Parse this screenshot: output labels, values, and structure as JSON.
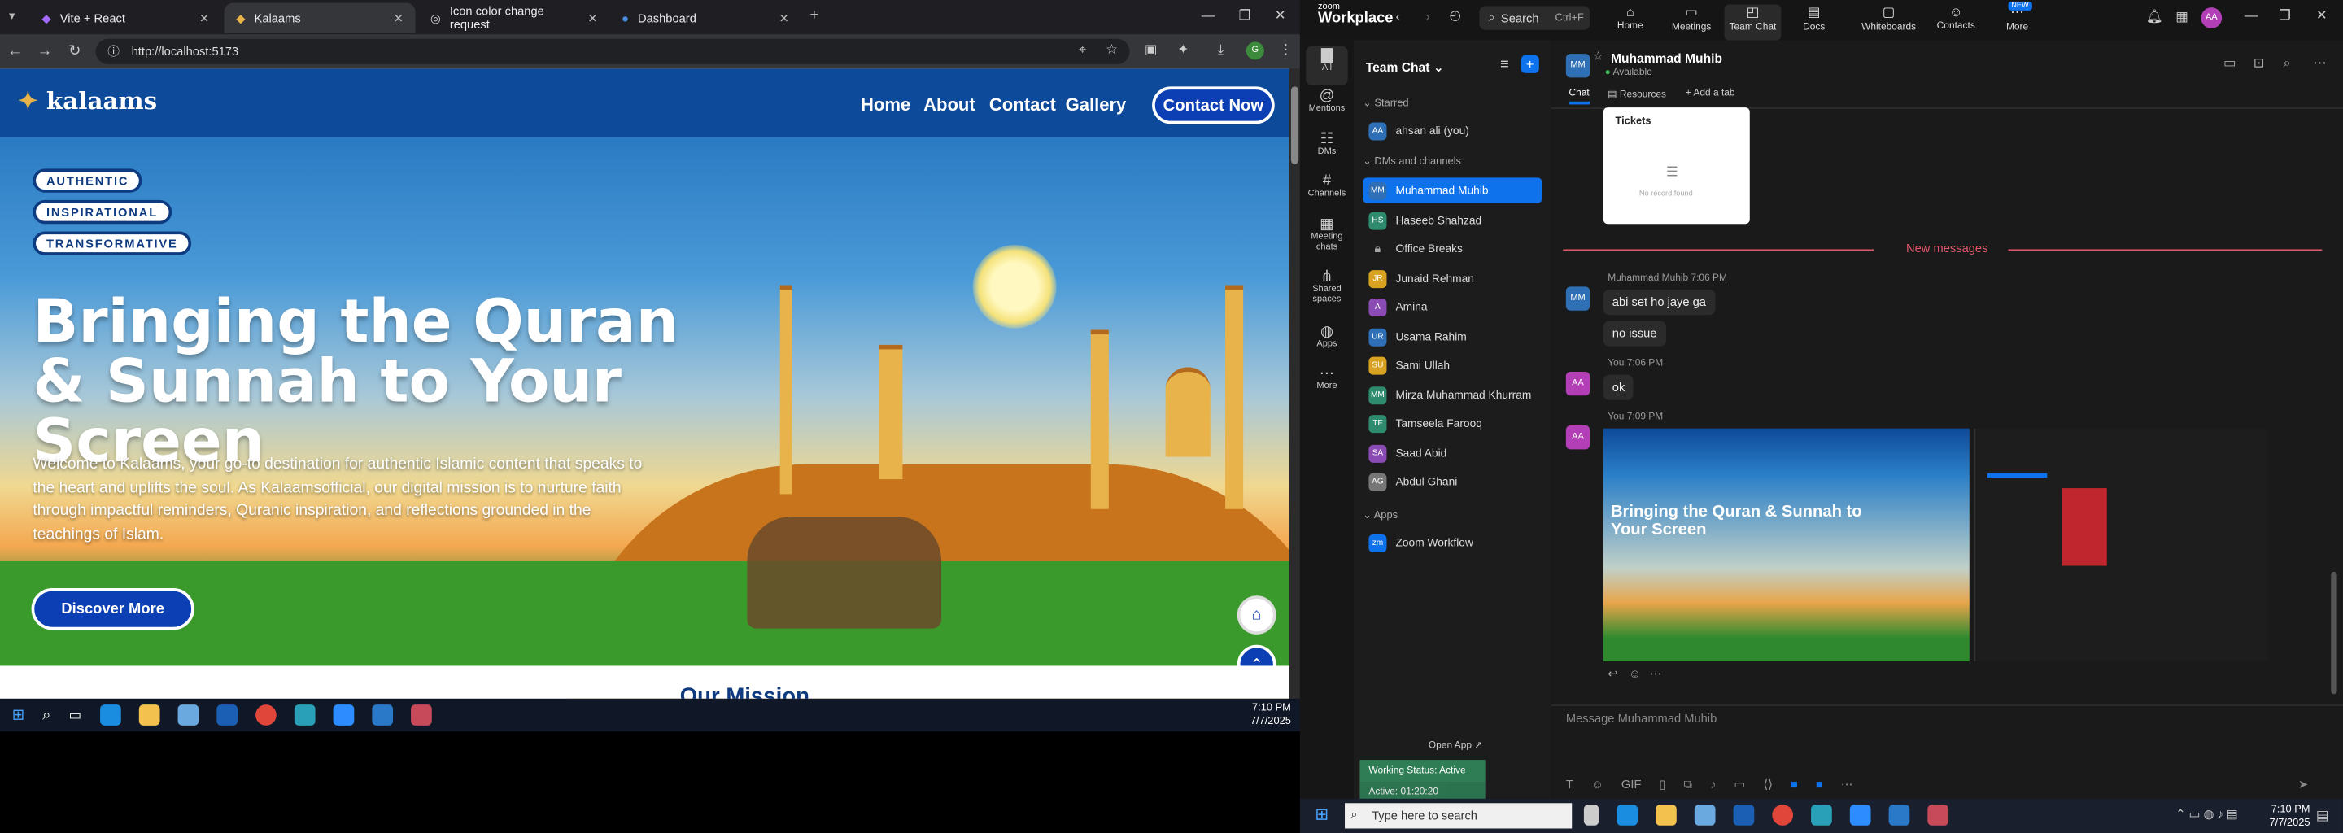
{
  "browser": {
    "tabs": [
      {
        "label": "Vite + React"
      },
      {
        "label": "Kalaams"
      },
      {
        "label": "Icon color change request"
      },
      {
        "label": "Dashboard"
      }
    ],
    "url": "http://localhost:5173"
  },
  "site": {
    "logo": "kalaams",
    "nav": [
      "Home",
      "About",
      "Contact",
      "Gallery"
    ],
    "contact_button": "Contact Now",
    "pills": [
      "AUTHENTIC",
      "INSPIRATIONAL",
      "TRANSFORMATIVE"
    ],
    "hero_title": "Bringing the Quran & Sunnah to Your Screen",
    "hero_text": "Welcome to Kalaams, your go-to destination for authentic Islamic content that speaks to the heart and uplifts the soul. As Kalaamsofficial, our digital mission is to nurture faith through impactful reminders, Quranic inspiration, and reflections grounded in the teachings of Islam.",
    "discover_button": "Discover More",
    "below_hint": "Our Mission"
  },
  "taskbar_left": {
    "time": "7:10 PM",
    "date": "7/7/2025"
  },
  "zoom": {
    "brand_top": "zoom",
    "brand": "Workplace",
    "search_label": "Search",
    "search_shortcut": "Ctrl+F",
    "top_tabs": [
      "Home",
      "Meetings",
      "Team Chat",
      "Docs",
      "Whiteboards",
      "Contacts",
      "More"
    ],
    "new_badge": "NEW",
    "avatar": "AA",
    "rail": [
      "All",
      "Mentions",
      "DMs",
      "Channels",
      "Meeting chats",
      "Shared spaces",
      "Apps",
      "More"
    ],
    "list_title": "Team Chat",
    "starred_label": "Starred",
    "starred": [
      {
        "name": "ahsan ali (you)",
        "initials": "AA"
      }
    ],
    "dms_label": "DMs and channels",
    "dms": [
      {
        "name": "Muhammad Muhib",
        "initials": "MM"
      },
      {
        "name": "Haseeb Shahzad",
        "initials": "HS"
      },
      {
        "name": "Office Breaks",
        "initials": ""
      },
      {
        "name": "Junaid Rehman",
        "initials": "JR"
      },
      {
        "name": "Amina",
        "initials": "A"
      },
      {
        "name": "Usama Rahim",
        "initials": "UR"
      },
      {
        "name": "Sami Ullah",
        "initials": "SU"
      },
      {
        "name": "Mirza Muhammad Khurram",
        "initials": "MM"
      },
      {
        "name": "Tamseela Farooq",
        "initials": "TF"
      },
      {
        "name": "Saad Abid",
        "initials": "SA"
      },
      {
        "name": "Abdul Ghani",
        "initials": "AG"
      }
    ],
    "apps_label": "Apps",
    "apps": [
      {
        "name": "Zoom Workflow",
        "initials": "zm"
      }
    ],
    "open_app": "Open App ↗",
    "working_status": "Working Status: Active",
    "active_timer": "Active: 01:20:20",
    "chat": {
      "name": "Muhammad Muhib",
      "status": "Available",
      "tabs": [
        "Chat",
        "Resources",
        "+ Add a tab"
      ],
      "ticket_title": "Tickets",
      "ticket_empty": "No record found",
      "new_messages": "New messages",
      "messages": [
        {
          "meta": "Muhammad Muhib 7:06 PM",
          "texts": [
            "abi set ho jaye ga",
            "no issue"
          ]
        },
        {
          "meta": "You 7:06 PM",
          "texts": [
            "ok"
          ]
        },
        {
          "meta": "You 7:09 PM",
          "texts": []
        }
      ],
      "screenshot_title": "Bringing the Quran & Sunnah to Your Screen",
      "composer_placeholder": "Message Muhammad Muhib"
    }
  },
  "taskbar_right": {
    "search_placeholder": "Type here to search",
    "time": "7:10 PM",
    "date": "7/7/2025"
  },
  "colors": {
    "site_nav": "#0e4a9a",
    "button_blue": "#0d3fb4",
    "zoom_accent": "#0e72ed",
    "new_messages": "#e2566c"
  }
}
